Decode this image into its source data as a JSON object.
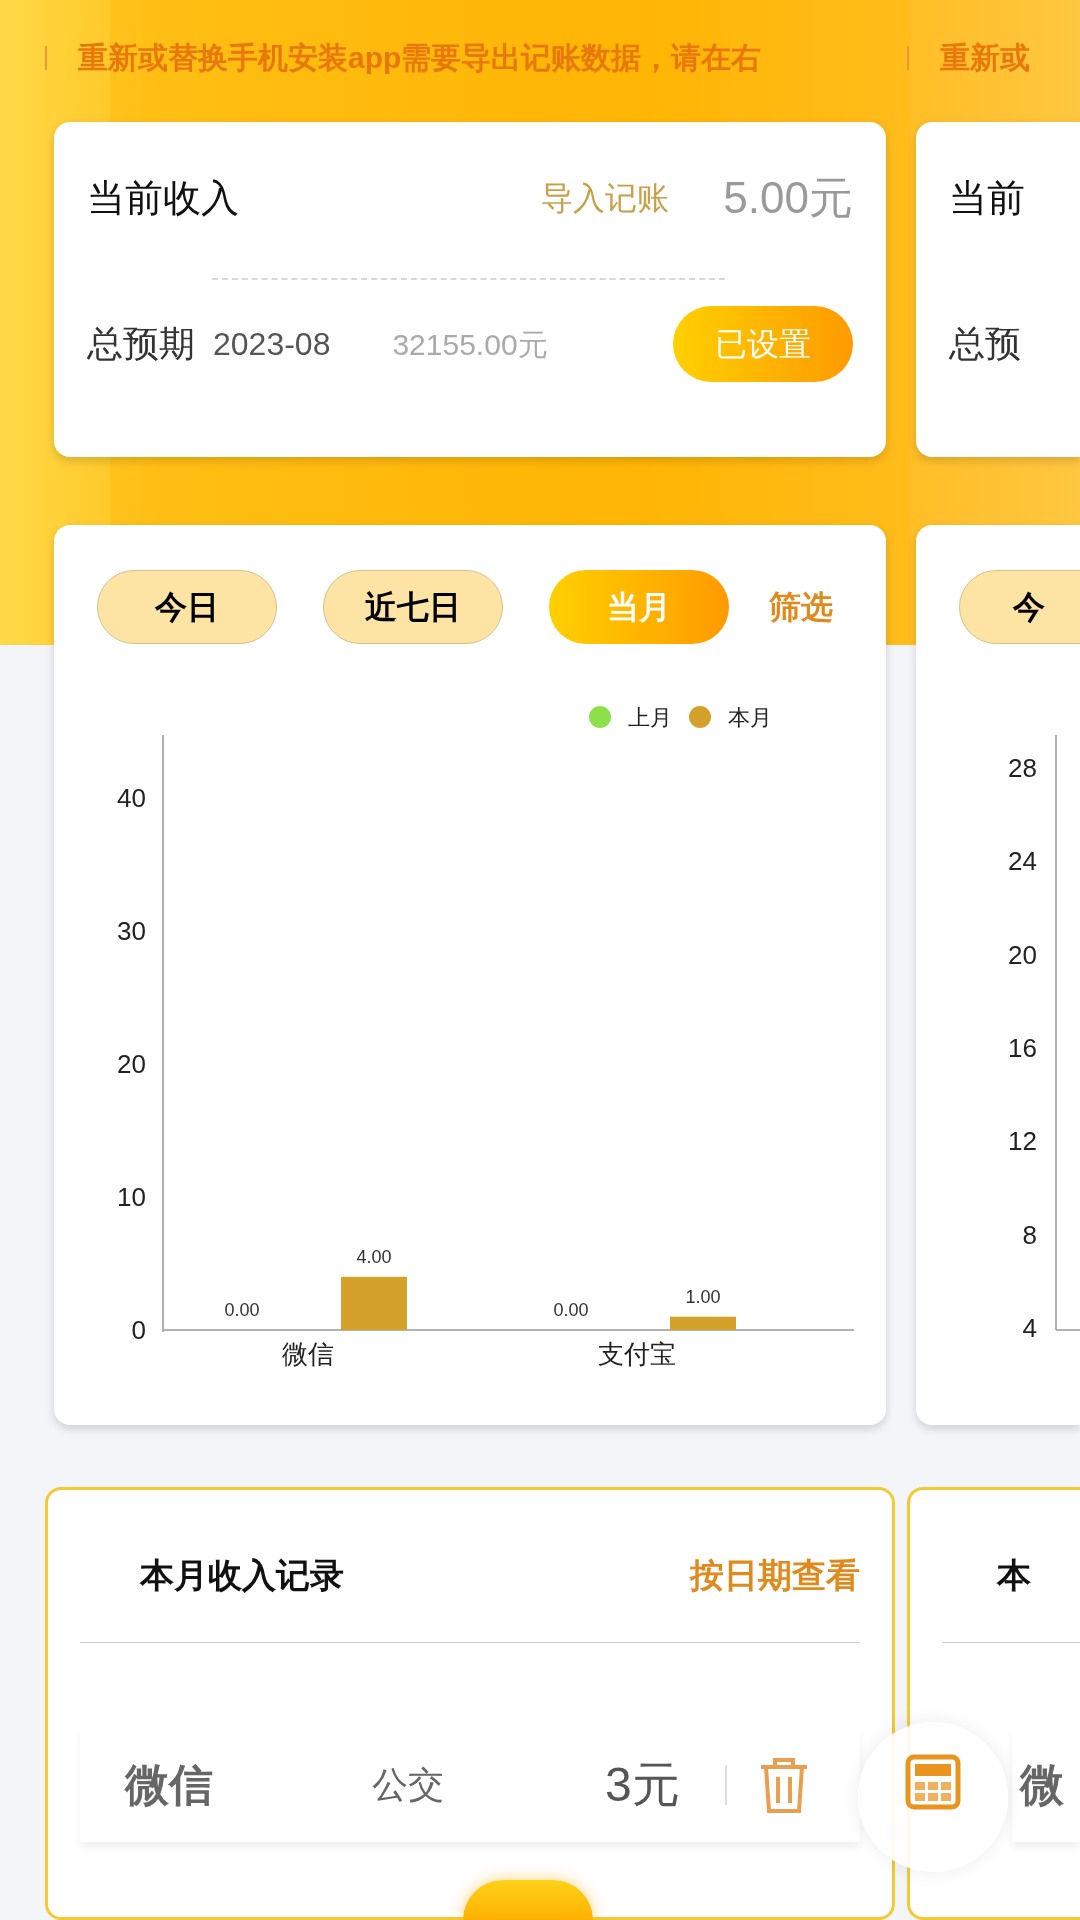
{
  "notice": {
    "text": "重新或替换手机安装app需要导出记账数据，请在右"
  },
  "income_card": {
    "title": "当前收入",
    "import_link": "导入记账",
    "amount": "5.00元",
    "budget_label": "总预期",
    "budget_month": "2023-08",
    "budget_amount": "32155.00元",
    "budget_button": "已设置"
  },
  "chart_card": {
    "tabs": [
      {
        "label": "今日",
        "selected": false
      },
      {
        "label": "近七日",
        "selected": false
      },
      {
        "label": "当月",
        "selected": true
      }
    ],
    "filter": "筛选",
    "chart_data": {
      "type": "bar",
      "categories": [
        "微信",
        "支付宝"
      ],
      "series": [
        {
          "name": "上月",
          "color": "#8ee04a",
          "values": [
            0,
            0
          ]
        },
        {
          "name": "本月",
          "color": "#d4a22a",
          "values": [
            4,
            1
          ]
        }
      ],
      "ylim": [
        0,
        44.74
      ],
      "yticks": [
        0,
        10,
        20,
        30,
        40
      ],
      "legend": true,
      "value_labels": [
        [
          "0.00",
          "0.00"
        ],
        [
          "4.00",
          "1.00"
        ]
      ]
    }
  },
  "records_card": {
    "title": "本月收入记录",
    "by_date_link": "按日期查看",
    "records": [
      {
        "account": "微信",
        "category": "公交",
        "amount": "3元"
      }
    ]
  },
  "next_page": {
    "notice": "重新或",
    "card_title": "当前",
    "budget_label": "总预",
    "tab": "今",
    "axis_labels": [
      "28",
      "24",
      "20",
      "16",
      "12",
      "8",
      "4"
    ],
    "records_title": "本",
    "record_account": "微"
  }
}
